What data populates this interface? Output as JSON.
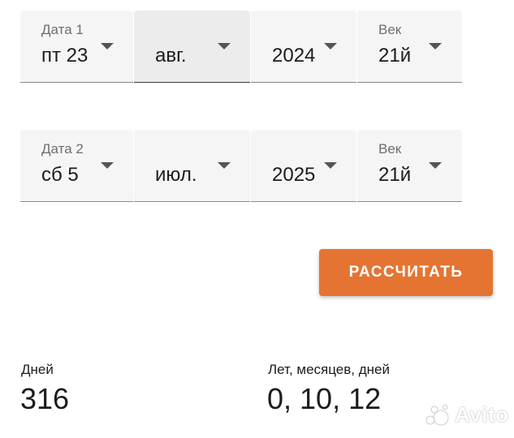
{
  "date1": {
    "label": "Дата 1",
    "day": "пт 23",
    "month": "авг.",
    "year": "2024",
    "century_label": "Век",
    "century": "21й"
  },
  "date2": {
    "label": "Дата 2",
    "day": "сб 5",
    "month": "июл.",
    "year": "2025",
    "century_label": "Век",
    "century": "21й"
  },
  "calculate_button": {
    "label": "РАССЧИТАТЬ",
    "color": "#e57432"
  },
  "results": {
    "days_label": "Дней",
    "days_value": "316",
    "ymd_label": "Лет, месяцев, дней",
    "ymd_value": "0, 10, 12"
  },
  "watermark": {
    "text": "Avito"
  }
}
